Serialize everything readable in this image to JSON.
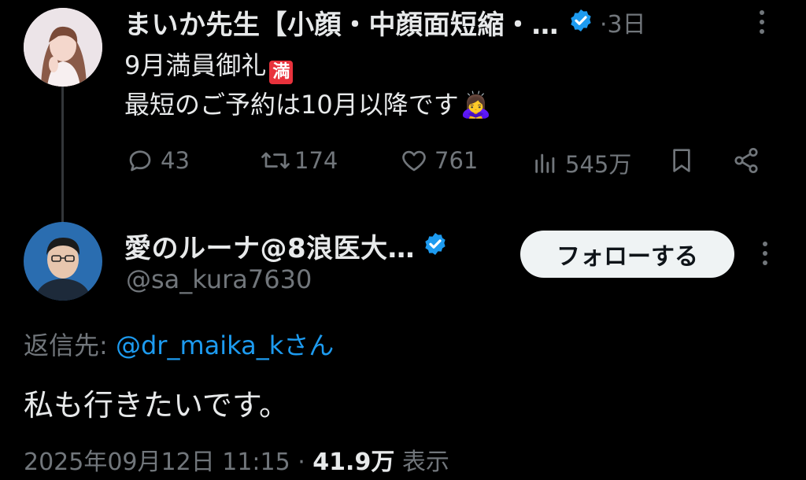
{
  "tweet": {
    "author_name": "まいか先生【小顔・中顔面短縮・…",
    "time": "·3日",
    "line1": "9月満員御礼",
    "full_badge": "満",
    "line2": "最短のご予約は10月以降です",
    "emoji": "🙇‍♀️",
    "stats": {
      "replies": "43",
      "retweets": "174",
      "likes": "761",
      "views": "545万"
    }
  },
  "reply": {
    "author_name": "愛のルーナ@8浪医大…",
    "handle": "@sa_kura7630",
    "follow_label": "フォローする",
    "reply_to_prefix": "返信先: ",
    "reply_to_handle": "@dr_maika_kさん",
    "text": "私も行きたいです。",
    "timestamp": "2025年09月12日 11:15 · ",
    "view_count": "41.9万",
    "view_label": " 表示"
  },
  "colors": {
    "background": "#000000",
    "text": "#e7e9ea",
    "muted": "#71767b",
    "link": "#1d9bf0",
    "verified": "#1d9bf0"
  },
  "icons": [
    "verified-badge-icon",
    "more-icon",
    "reply-icon",
    "retweet-icon",
    "like-icon",
    "views-icon",
    "bookmark-icon",
    "share-icon"
  ]
}
